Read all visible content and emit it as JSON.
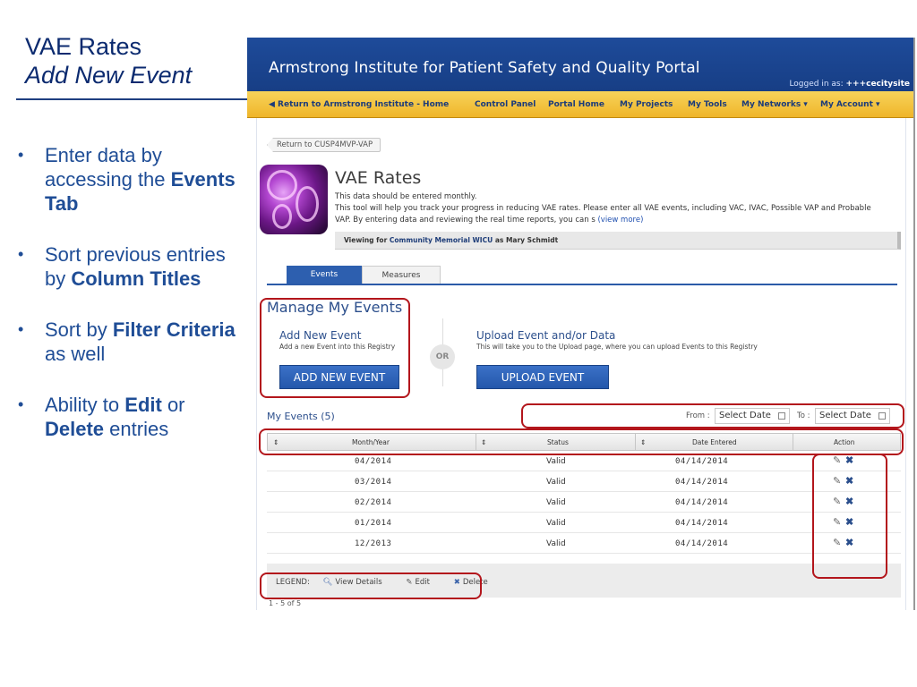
{
  "slide": {
    "title_line1": "VAE Rates",
    "title_line2": "Add New Event",
    "bullets": [
      {
        "pre": "Enter data by accessing the ",
        "bold": "Events Tab",
        "post": ""
      },
      {
        "pre": "Sort previous entries by ",
        "bold": "Column Titles",
        "post": ""
      },
      {
        "pre": "Sort by ",
        "bold": "Filter Criteria",
        "post": " as well"
      },
      {
        "pre": "Ability to ",
        "bold": "Edit",
        "mid": " or ",
        "bold2": "Delete",
        "post": " entries"
      }
    ]
  },
  "portal": {
    "title": "Armstrong Institute for Patient Safety and Quality Portal",
    "logged_in_label": "Logged in as: ",
    "logged_in_user": "+++cecitysite",
    "nav": {
      "home": "◀ Return to Armstrong Institute - Home",
      "control_panel": "Control Panel",
      "portal_home": "Portal Home",
      "my_projects": "My Projects",
      "my_tools": "My Tools",
      "my_networks": "My Networks ▾",
      "my_account": "My Account ▾"
    }
  },
  "page": {
    "back_link": "Return to CUSP4MVP-VAP",
    "tool_title": "VAE Rates",
    "desc_line1": "This data should be entered monthly.",
    "desc_line2": "This tool will help you track your progress in reducing VAE rates. Please enter all VAE events, including VAC, IVAC, Possible VAP and Probable",
    "desc_line3": "VAP. By entering data and reviewing the real time reports, you can s",
    "view_more": "(view more)",
    "viewing_label": "Viewing  for ",
    "viewing_unit": "Community Memorial WICU",
    "viewing_as": "as Mary Schmidt",
    "tabs": {
      "events": "Events",
      "measures": "Measures"
    },
    "manage_title": "Manage My Events",
    "add_title": "Add New Event",
    "add_desc": "Add a new Event into this Registry",
    "add_button": "ADD NEW EVENT",
    "or_label": "OR",
    "upload_title": "Upload Event and/or Data",
    "upload_desc": "This will take you to the Upload page, where you can upload Events to this Registry",
    "upload_button": "UPLOAD EVENT",
    "my_events": "My Events (5)",
    "from_label": "From :",
    "to_label": "To :",
    "date_placeholder": "Select Date"
  },
  "table": {
    "sort_glyph": "⇕",
    "headers": {
      "month": "Month/Year",
      "status": "Status",
      "date": "Date Entered",
      "action": "Action"
    },
    "rows": [
      {
        "month": "04/2014",
        "status": "Valid",
        "date": "04/14/2014"
      },
      {
        "month": "03/2014",
        "status": "Valid",
        "date": "04/14/2014"
      },
      {
        "month": "02/2014",
        "status": "Valid",
        "date": "04/14/2014"
      },
      {
        "month": "01/2014",
        "status": "Valid",
        "date": "04/14/2014"
      },
      {
        "month": "12/2013",
        "status": "Valid",
        "date": "04/14/2014"
      }
    ]
  },
  "legend": {
    "label": "LEGEND:",
    "view_details": "View Details",
    "edit": "Edit",
    "delete": "Delete",
    "icons": {
      "view": "magnifier-icon",
      "edit": "pencil-icon",
      "delete": "x-icon"
    }
  },
  "pager": "1 - 5 of 5",
  "colors": {
    "header_blue": "#1e4b9a",
    "nav_gold": "#efb52a",
    "button_blue": "#2d5faf",
    "annotation_red": "#b3161c",
    "slide_text_blue": "#1f4d96"
  }
}
